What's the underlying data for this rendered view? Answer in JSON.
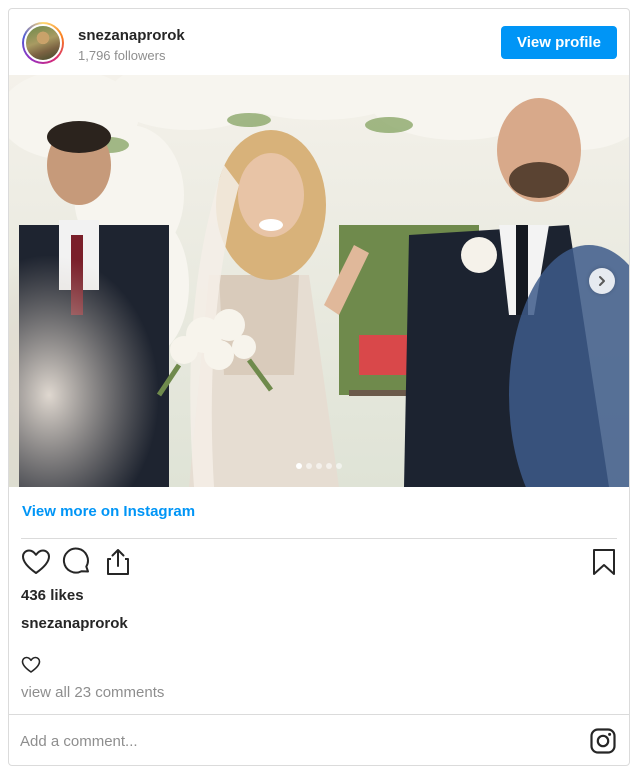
{
  "header": {
    "username": "snezanaprorok",
    "followers": "1,796 followers",
    "view_profile_label": "View profile"
  },
  "photo": {
    "slide_count": 5,
    "active_slide": 1
  },
  "links": {
    "view_more_label": "View more on Instagram"
  },
  "stats": {
    "likes": "436 likes",
    "owner": "snezanaprorok",
    "view_comments": "view all 23 comments"
  },
  "comment": {
    "placeholder": "Add a comment..."
  },
  "colors": {
    "accent": "#0095f6",
    "text": "#262626",
    "muted": "#8e8e8e",
    "border": "#dbdbdb"
  },
  "icons": {
    "like": "heart-icon",
    "comment": "comment-bubble-icon",
    "share": "share-icon",
    "save": "bookmark-icon",
    "next": "chevron-right-icon",
    "brand": "instagram-icon"
  }
}
